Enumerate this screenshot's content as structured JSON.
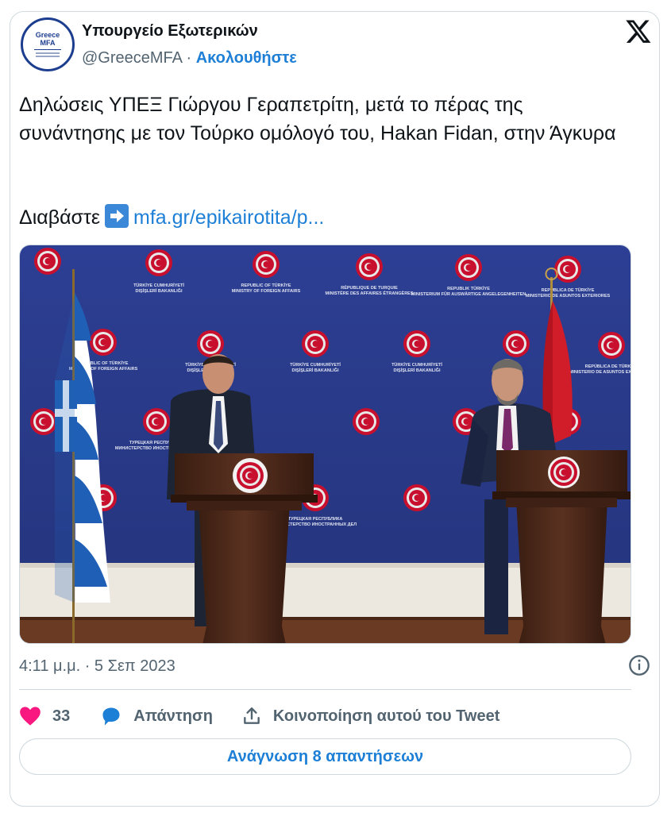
{
  "account": {
    "name": "Υπουργείο Εξωτερικών",
    "handle": "@GreeceMFA",
    "separator": "·",
    "follow_label": "Ακολουθήστε",
    "avatar_line1": "Greece",
    "avatar_line2": "MFA"
  },
  "tweet": {
    "text": "Δηλώσεις ΥΠΕΞ Γιώργου Γεραπετρίτη, μετά το πέρας της συνάντησης με τον Τούρκο ομόλογό του, Hakan Fidan, στην Άγκυρα",
    "read_label": "Διαβάστε",
    "link_text": "mfa.gr/epikairotita/p...",
    "timestamp": "4:11 μ.μ. · 5 Σεπ 2023"
  },
  "media": {
    "backdrop_lines": [
      [
        "REPUBLIC OF TÜRKİYE",
        "MINISTRY OF FOREIGN AFFAIRS"
      ],
      [
        "TÜRKİYE CUMHURİYETİ",
        "DIŞİŞLERİ BAKANLIĞI"
      ],
      [
        "RÉPUBLIQUE DE TURQUIE",
        "MINISTÈRE DES AFFAIRES ÉTRANGÈRES"
      ],
      [
        "REPUBLIK TÜRKİYE",
        "MINISTERIUM FÜR AUSWÄRTIGE ANGELEGENHEITEN"
      ],
      [
        "REPÚBLICA DE TÜRKİYE",
        "MINISTERIO DE ASUNTOS EXTERIORES"
      ],
      [
        "ТУРЕЦКАЯ РЕСПУБЛИКА",
        "МИНИСТЕРСТВО ИНОСТРАННЫХ ДЕЛ"
      ]
    ]
  },
  "actions": {
    "likes": "33",
    "reply_label": "Απάντηση",
    "share_label": "Κοινοποίηση αυτού του Tweet",
    "read_replies": "Ανάγνωση 8 απαντήσεων"
  },
  "colors": {
    "accent": "#1d7fd6",
    "like": "#f91880",
    "backdrop": "#2a3a8a"
  }
}
